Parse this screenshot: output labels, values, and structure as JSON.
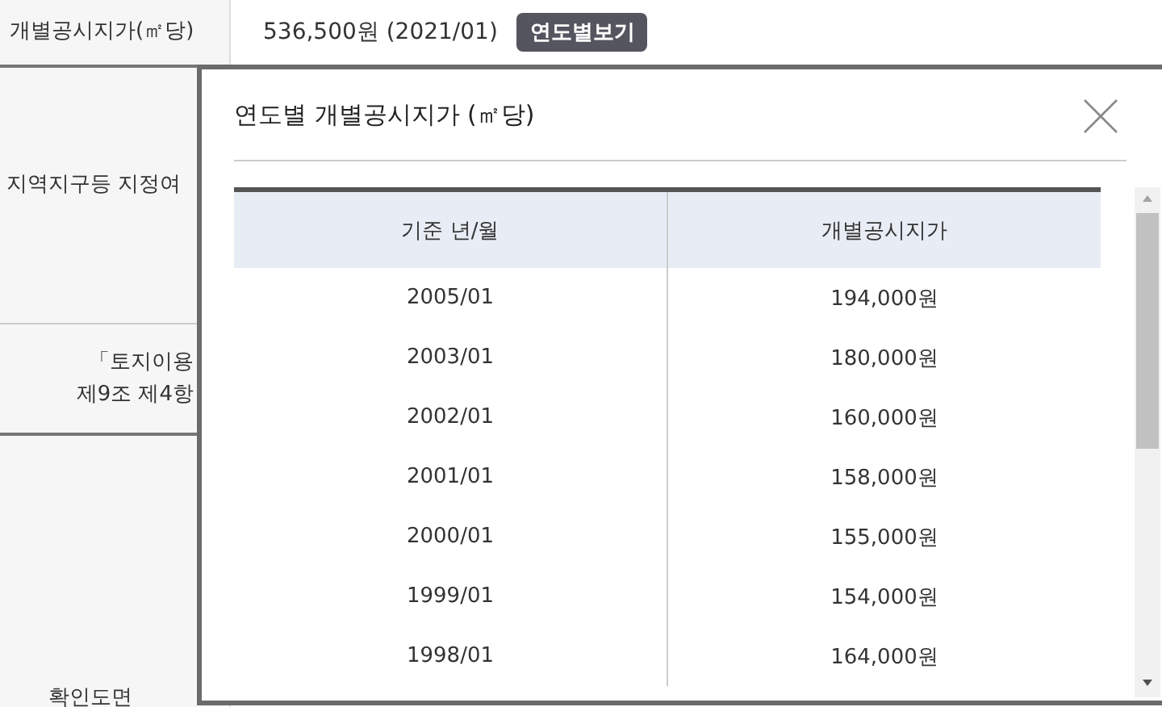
{
  "price_row": {
    "label": "개별공시지가(㎡당)",
    "value": "536,500원 (2021/01)",
    "button": "연도별보기"
  },
  "rows": [
    {
      "lines": [
        "지역지구등 지정여"
      ]
    },
    {
      "lines": [
        "「토지이용",
        "제9조 제4항"
      ]
    },
    {
      "lines": [
        "확인도면"
      ]
    }
  ],
  "modal": {
    "title": "연도별 개별공시지가 (㎡당)",
    "table": {
      "columns": [
        "기준 년/월",
        "개별공시지가"
      ],
      "rows": [
        [
          "2005/01",
          "194,000원"
        ],
        [
          "2003/01",
          "180,000원"
        ],
        [
          "2002/01",
          "160,000원"
        ],
        [
          "2001/01",
          "158,000원"
        ],
        [
          "2000/01",
          "155,000원"
        ],
        [
          "1999/01",
          "154,000원"
        ],
        [
          "1998/01",
          "164,000원"
        ]
      ]
    }
  }
}
